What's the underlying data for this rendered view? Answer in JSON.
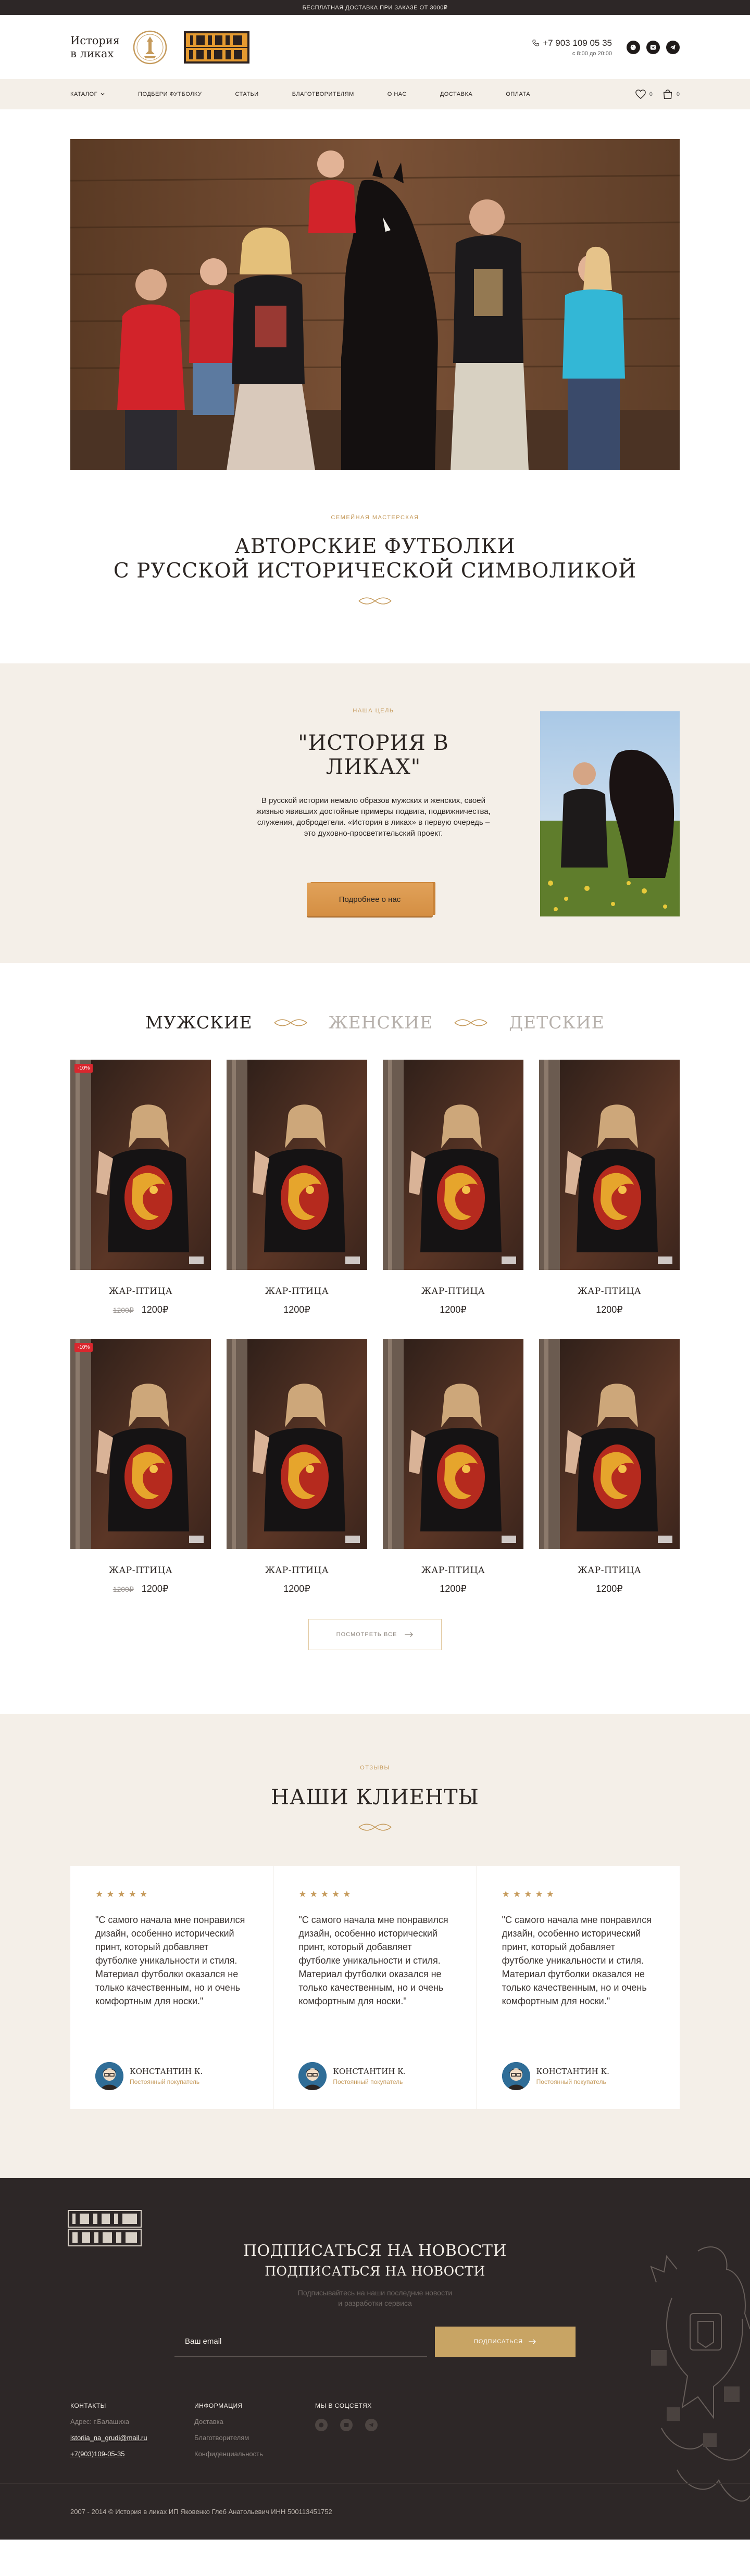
{
  "topbar": {
    "text": "Бесплатная доставка при заказе от 3000₽"
  },
  "header": {
    "logo_text": "История\nв ликах",
    "phone": "+7 903 109 05 35",
    "hours": "с 8:00 до 20:00",
    "social": [
      "whatsapp-icon",
      "vk-icon",
      "telegram-icon"
    ]
  },
  "nav": {
    "items": [
      "Каталог",
      "Подбери футболку",
      "Статьи",
      "Благотворителям",
      "О нас",
      "Доставка",
      "Оплата"
    ],
    "wishlist_count": "0",
    "cart_count": "0"
  },
  "intro": {
    "kicker": "Семейная мастерская",
    "title": "Авторские футболки\nс русской исторической символикой"
  },
  "mission": {
    "kicker": "Наша цель",
    "title": "\"ИСТОРИЯ В ЛИКАХ\"",
    "text": "В русской истории немало образов мужских и женских, своей жизнью явивших достойные примеры подвига, подвижничества, служения, добродетели. «История в ликах» в первую очередь – это духовно-просветительский проект.",
    "button": "Подробнее о нас"
  },
  "catalog": {
    "tabs": [
      "Мужские",
      "Женские",
      "Детские"
    ],
    "active_tab": "Мужские",
    "products": [
      {
        "title": "Жар-птица",
        "price": "1200₽",
        "old_price": "1200₽",
        "badge": "-10%"
      },
      {
        "title": "Жар-птица",
        "price": "1200₽",
        "old_price": "",
        "badge": ""
      },
      {
        "title": "Жар-птица",
        "price": "1200₽",
        "old_price": "",
        "badge": ""
      },
      {
        "title": "Жар-птица",
        "price": "1200₽",
        "old_price": "",
        "badge": ""
      },
      {
        "title": "Жар-птица",
        "price": "1200₽",
        "old_price": "1200₽",
        "badge": "-10%"
      },
      {
        "title": "Жар-птица",
        "price": "1200₽",
        "old_price": "",
        "badge": ""
      },
      {
        "title": "Жар-птица",
        "price": "1200₽",
        "old_price": "",
        "badge": ""
      },
      {
        "title": "Жар-птица",
        "price": "1200₽",
        "old_price": "",
        "badge": ""
      }
    ],
    "view_all": "Посмотреть все"
  },
  "reviews": {
    "kicker": "Отзывы",
    "title": "Наши клиенты",
    "items": [
      {
        "stars": "★★★★★",
        "text": "\"С самого начала мне понравился дизайн, особенно исторический принт, который добавляет футболке уникальности и стиля. Материал футболки оказался не только качественным, но и очень комфортным для носки.\"",
        "name": "Константин К.",
        "role": "Постоянный покупатель"
      },
      {
        "stars": "★★★★★",
        "text": "\"С самого начала мне понравился дизайн, особенно исторический принт, который добавляет футболке уникальности и стиля. Материал футболки оказался не только качественным, но и очень комфортным для носки.\"",
        "name": "Константин К.",
        "role": "Постоянный покупатель"
      },
      {
        "stars": "★★★★★",
        "text": "\"С самого начала мне понравился дизайн, особенно исторический принт, который добавляет футболке уникальности и стиля. Материал футболки оказался не только качественным, но и очень комфортным для носки.\"",
        "name": "Константин К.",
        "role": "Постоянный покупатель"
      }
    ]
  },
  "footer": {
    "sub_title": "Подписаться на новости",
    "sub_title2": "Подписаться на новости",
    "sub_desc": "Подписывайтесь на наши последние новости\nи разработки сервиса",
    "email_placeholder": "Ваш email",
    "sub_button": "Подписаться",
    "contacts_title": "Контакты",
    "address": "Адрес: г.Балашиха",
    "email": "istoriia_na_grudi@mail.ru",
    "phone": "+7(903)109-05-35",
    "info_title": "Информация",
    "info_links": [
      "Доставка",
      "Благотворителям",
      "Конфиденциальность"
    ],
    "social_title": "Мы в соцсетях",
    "copyright": "2007 - 2014 © История в ликах ИП Яковенко Глеб Анатольевич ИНН 500113451752"
  },
  "colors": {
    "accent": "#c59a5b",
    "dark": "#2d2727",
    "beige": "#f4efe8",
    "badge": "#d9272e"
  }
}
